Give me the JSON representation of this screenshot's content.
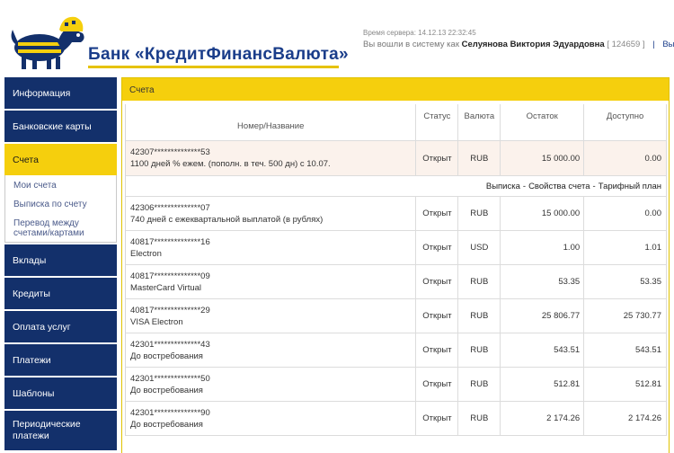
{
  "header": {
    "bank_name": "Банк «КредитФинансВалюта»",
    "server_time": "Время сервера: 14.12.13 22:32:45",
    "logged_in_prefix": "Вы вошли в систему как",
    "user_name": "Селуянова Виктория Эдуардовна",
    "user_id": "[ 124659 ]",
    "separator": "|",
    "logout": "Выйти"
  },
  "sidebar": {
    "items": [
      {
        "label": "Информация"
      },
      {
        "label": "Банковские карты"
      },
      {
        "label": "Счета",
        "active": true
      },
      {
        "label": "Вклады"
      },
      {
        "label": "Кредиты"
      },
      {
        "label": "Оплата услуг"
      },
      {
        "label": "Платежи"
      },
      {
        "label": "Шаблоны"
      },
      {
        "label": "Периодические платежи"
      }
    ],
    "submenu": [
      {
        "label": "Мои счета"
      },
      {
        "label": "Выписка по счету"
      },
      {
        "label": "Перевод между счетами/картами"
      }
    ]
  },
  "panel": {
    "title": "Счета",
    "columns": [
      "Номер/Название",
      "Статус",
      "Валюта",
      "Остаток",
      "Доступно"
    ],
    "links": [
      "Выписка",
      "Свойства счета",
      "Тарифный план"
    ],
    "accounts": [
      {
        "number": "42307**************53",
        "name": "1100 дней % ежем. (пополн. в теч. 500 дн) с 10.07.",
        "status": "Открыт",
        "currency": "RUB",
        "balance": "15 000.00",
        "available": "0.00"
      },
      {
        "number": "42306**************07",
        "name": "740 дней с ежеквартальной выплатой (в рублях)",
        "status": "Открыт",
        "currency": "RUB",
        "balance": "15 000.00",
        "available": "0.00"
      },
      {
        "number": "40817**************16",
        "name": "Electron",
        "status": "Открыт",
        "currency": "USD",
        "balance": "1.00",
        "available": "1.01"
      },
      {
        "number": "40817**************09",
        "name": "MasterCard Virtual",
        "status": "Открыт",
        "currency": "RUB",
        "balance": "53.35",
        "available": "53.35"
      },
      {
        "number": "40817**************29",
        "name": "VISA Electron",
        "status": "Открыт",
        "currency": "RUB",
        "balance": "25 806.77",
        "available": "25 730.77"
      },
      {
        "number": "42301**************43",
        "name": "До востребования",
        "status": "Открыт",
        "currency": "RUB",
        "balance": "543.51",
        "available": "543.51"
      },
      {
        "number": "42301**************50",
        "name": "До востребования",
        "status": "Открыт",
        "currency": "RUB",
        "balance": "512.81",
        "available": "512.81"
      },
      {
        "number": "42301**************90",
        "name": "До востребования",
        "status": "Открыт",
        "currency": "RUB",
        "balance": "2 174.26",
        "available": "2 174.26"
      }
    ]
  },
  "colors": {
    "nav_bg": "#13306b",
    "accent_yellow": "#f5cf0d",
    "brand_blue": "#1a3d8a",
    "highlight_row": "#fbf2ec"
  }
}
